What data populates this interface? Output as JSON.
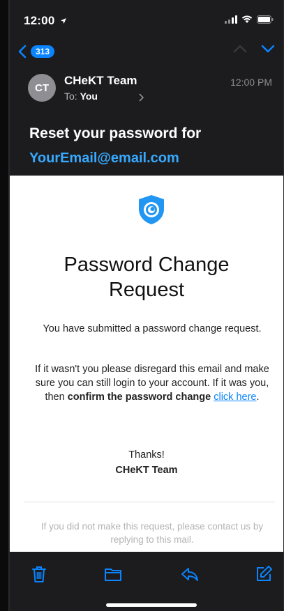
{
  "status_bar": {
    "time": "12:00"
  },
  "nav": {
    "unread_count": "313"
  },
  "message": {
    "avatar_initials": "CT",
    "sender_name": "CHeKT Team",
    "to_prefix": "To:",
    "to_value": "You",
    "time": "12:00 PM",
    "subject_line1": "Reset your password for",
    "subject_line2": "YourEmail@email.com"
  },
  "email": {
    "title_line1": "Password Change",
    "title_line2": "Request",
    "paragraph1": "You have submitted a password change request.",
    "paragraph2_text": "If it wasn't you please disregard this email and make sure you can still login to your account. If it was you, then",
    "paragraph2_bold": "confirm the password change",
    "link_text": "click here",
    "link_suffix": ".",
    "thanks": "Thanks!",
    "signature": "CHeKT Team",
    "footer_note": "If you did not make this request, please contact us by replying to this mail."
  },
  "colors": {
    "accent": "#0a84ff",
    "subject_email": "#37a9ff",
    "dark_bg": "#1c1c1e",
    "logo_blue": "#2196f3"
  },
  "icons": {
    "logo": "shield-logo-icon",
    "toolbar": [
      "trash-icon",
      "folder-icon",
      "reply-icon",
      "compose-icon"
    ]
  }
}
